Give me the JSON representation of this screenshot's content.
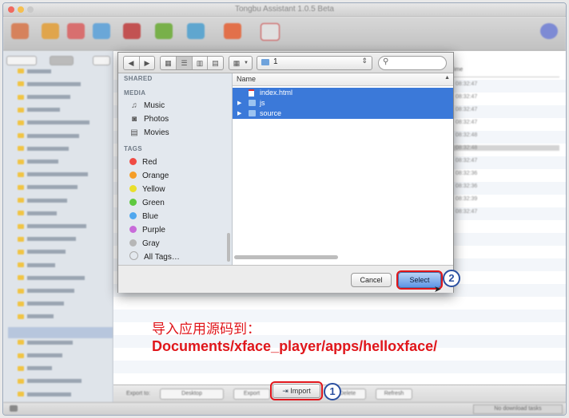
{
  "window": {
    "title": "Tongbu Assistant 1.0.5 Beta"
  },
  "dialog": {
    "path_popup": "1",
    "search_placeholder": "",
    "sidebar": {
      "shared_header": "SHARED",
      "media_header": "MEDIA",
      "media_items": [
        {
          "label": "Music",
          "icon": "music-note-icon"
        },
        {
          "label": "Photos",
          "icon": "camera-icon"
        },
        {
          "label": "Movies",
          "icon": "film-icon"
        }
      ],
      "tags_header": "TAGS",
      "tags": [
        {
          "label": "Red",
          "color": "#f04b44"
        },
        {
          "label": "Orange",
          "color": "#f59d27"
        },
        {
          "label": "Yellow",
          "color": "#eadf2b"
        },
        {
          "label": "Green",
          "color": "#5fc93f"
        },
        {
          "label": "Blue",
          "color": "#50a7ee"
        },
        {
          "label": "Purple",
          "color": "#c86bd9"
        },
        {
          "label": "Gray",
          "color": "#b6b6b6"
        },
        {
          "label": "All Tags…",
          "color": ""
        }
      ]
    },
    "files": {
      "column_name": "Name",
      "rows": [
        {
          "name": "index.html",
          "expandable": false,
          "icon": "html-file-icon"
        },
        {
          "name": "js",
          "expandable": true,
          "icon": "folder-icon"
        },
        {
          "name": "source",
          "expandable": true,
          "icon": "folder-icon"
        }
      ]
    },
    "cancel_label": "Cancel",
    "select_label": "Select"
  },
  "annotation": {
    "line1": "导入应用源码到：",
    "line2": "Documents/xface_player/apps/helloxface/"
  },
  "bottom": {
    "import_label": "Import",
    "export_label": "Export to:",
    "export_value": "Desktop",
    "export_button": "Export",
    "delete_button": "Delete",
    "refresh_button": "Refresh"
  },
  "status": {
    "right_text": "No download tasks"
  },
  "steps": {
    "one": "1",
    "two": "2"
  },
  "time_column": {
    "header": "Time",
    "values": [
      "08:32:47",
      "08:32:47",
      "08:32:47",
      "08:32:47",
      "08:32:48",
      "08:32:48",
      "08:32:47",
      "08:32:36",
      "08:32:36",
      "08:32:39",
      "08:32:47"
    ]
  },
  "colors": {
    "accent_selection": "#3b79d9",
    "annotation_red": "#e0161b",
    "badge_blue": "#2a4fa0"
  }
}
